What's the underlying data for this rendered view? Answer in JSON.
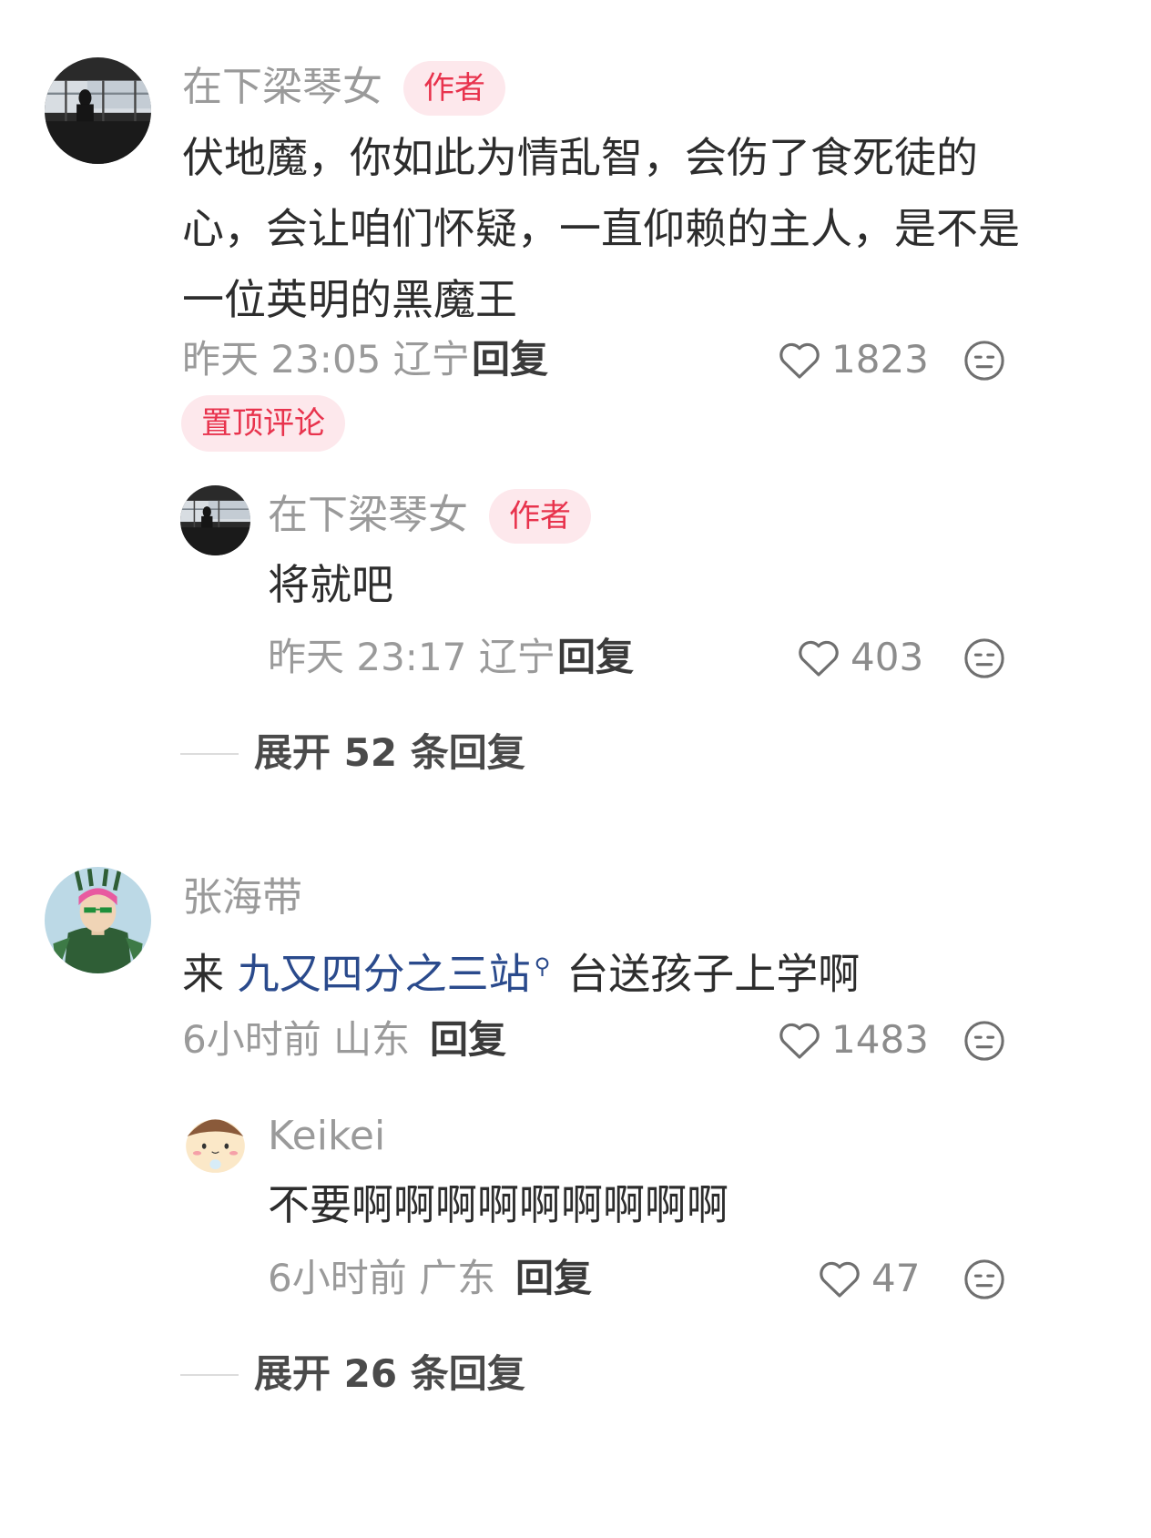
{
  "comments": [
    {
      "author": "在下梁琴女",
      "badge": "作者",
      "text": "伏地魔，你如此为情乱智，会伤了食死徒的心，会让咱们怀疑，一直仰赖的主人，是不是一位英明的黑魔王",
      "time": "昨天 23:05 辽宁",
      "reply_label": "回复",
      "likes": "1823",
      "pinned_label": "置顶评论",
      "replies": [
        {
          "author": "在下梁琴女",
          "badge": "作者",
          "text": "将就吧",
          "time": "昨天 23:17 辽宁",
          "reply_label": "回复",
          "likes": "403"
        }
      ],
      "expand_label": "展开 52 条回复"
    },
    {
      "author": "张海带",
      "text_prefix": "来 ",
      "text_link": "九又四分之三站",
      "text_suffix": "台送孩子上学啊",
      "time": "6小时前 山东",
      "reply_label": "回复",
      "likes": "1483",
      "replies": [
        {
          "author": "Keikei",
          "text": "不要啊啊啊啊啊啊啊啊啊",
          "time": "6小时前 广东",
          "reply_label": "回复",
          "likes": "47"
        }
      ],
      "expand_label": "展开 26 条回复"
    }
  ],
  "icons": {
    "like": "heart-outline-icon",
    "react": "neutral-face-icon",
    "link": "search-icon"
  },
  "colors": {
    "accent": "#e8334d",
    "badge_bg": "#fde8ec",
    "link": "#2a4a8c"
  }
}
